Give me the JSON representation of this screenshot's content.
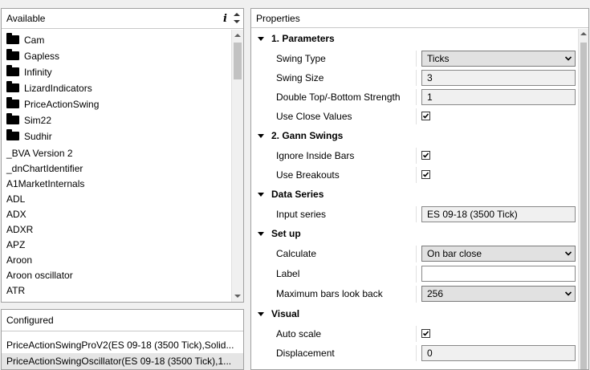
{
  "available": {
    "title": "Available",
    "info_glyph": "i",
    "folders": [
      "Cam",
      "Gapless",
      "Infinity",
      "LizardIndicators",
      "PriceActionSwing",
      "Sim22",
      "Sudhir"
    ],
    "items": [
      "_BVA Version 2",
      "_dnChartIdentifier",
      "A1MarketInternals",
      "ADL",
      "ADX",
      "ADXR",
      "APZ",
      "Aroon",
      "Aroon oscillator",
      "ATR"
    ]
  },
  "configured": {
    "title": "Configured",
    "items": [
      "PriceActionSwingProV2(ES 09-18 (3500 Tick),Solid...",
      "PriceActionSwingOscillator(ES 09-18 (3500 Tick),1..."
    ]
  },
  "properties": {
    "title": "Properties",
    "categories": [
      {
        "label": "1. Parameters",
        "rows": [
          {
            "label": "Swing Type",
            "value": "Ticks"
          },
          {
            "label": "Swing Size",
            "value": "3"
          },
          {
            "label": "Double Top/-Bottom Strength",
            "value": "1"
          },
          {
            "label": "Use Close Values",
            "checked": true
          }
        ]
      },
      {
        "label": "2. Gann Swings",
        "rows": [
          {
            "label": "Ignore Inside Bars",
            "checked": true
          },
          {
            "label": "Use Breakouts",
            "checked": true
          }
        ]
      },
      {
        "label": "Data Series",
        "rows": [
          {
            "label": "Input series",
            "value": "ES 09-18 (3500 Tick)"
          }
        ]
      },
      {
        "label": "Set up",
        "rows": [
          {
            "label": "Calculate",
            "value": "On bar close"
          },
          {
            "label": "Label",
            "value": ""
          },
          {
            "label": "Maximum bars look back",
            "value": "256"
          }
        ]
      },
      {
        "label": "Visual",
        "rows": [
          {
            "label": "Auto scale",
            "checked": true
          },
          {
            "label": "Displacement",
            "value": "0"
          }
        ]
      }
    ]
  },
  "colors": {
    "panel_bg": "#ffffff",
    "window_bg": "#f0f0f0",
    "selected_row": "#e5e5e5",
    "scroll_thumb": "#c2c2c2"
  }
}
